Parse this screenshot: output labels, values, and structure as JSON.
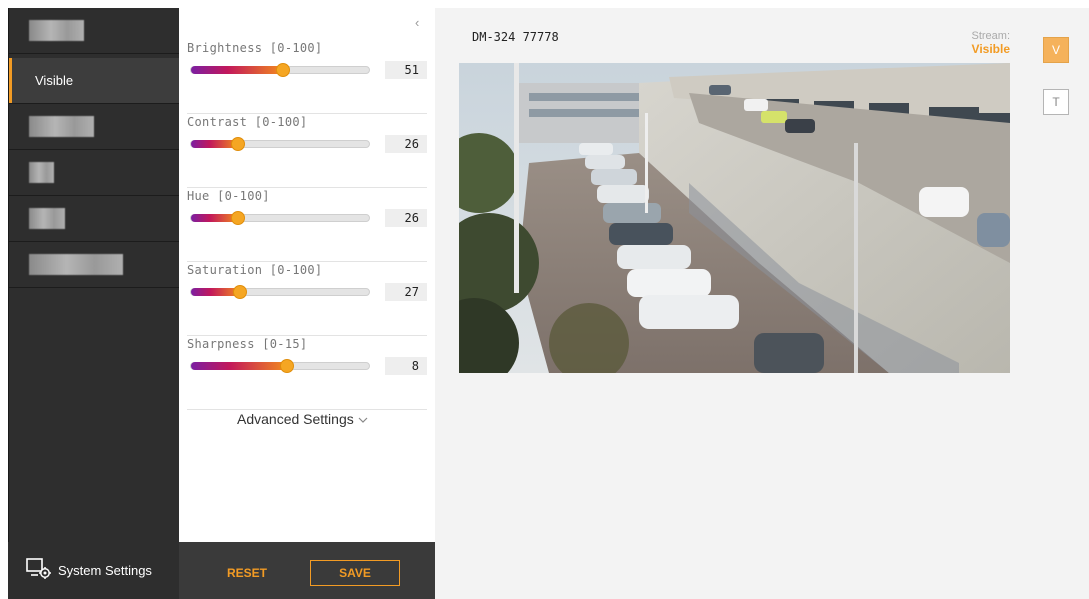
{
  "nav": {
    "items": [
      {
        "label": "",
        "redacted": true
      },
      {
        "label": "Visible",
        "active": true
      },
      {
        "label": "",
        "redacted": true
      },
      {
        "label": "",
        "redacted": true
      },
      {
        "label": "",
        "redacted": true
      },
      {
        "label": "",
        "redacted": true
      }
    ],
    "footer_label": "System Settings"
  },
  "panel": {
    "collapse_glyph": "‹",
    "settings": [
      {
        "name": "Brightness [0-100]",
        "value": "51",
        "fraction": 0.51
      },
      {
        "name": "Contrast [0-100]",
        "value": "26",
        "fraction": 0.26
      },
      {
        "name": "Hue [0-100]",
        "value": "26",
        "fraction": 0.26
      },
      {
        "name": "Saturation [0-100]",
        "value": "27",
        "fraction": 0.27
      },
      {
        "name": "Sharpness [0-15]",
        "value": "8",
        "fraction": 0.533
      }
    ],
    "advanced_label": "Advanced Settings",
    "reset_label": "RESET",
    "save_label": "SAVE"
  },
  "main": {
    "camera_name": "DM-324 77778",
    "stream_label": "Stream:",
    "stream_value": "Visible",
    "v_button": "V",
    "t_button": "T"
  },
  "colors": {
    "accent": "#f29b24",
    "nav_bg": "#2e2e2e",
    "panel_bg": "#ffffff"
  }
}
